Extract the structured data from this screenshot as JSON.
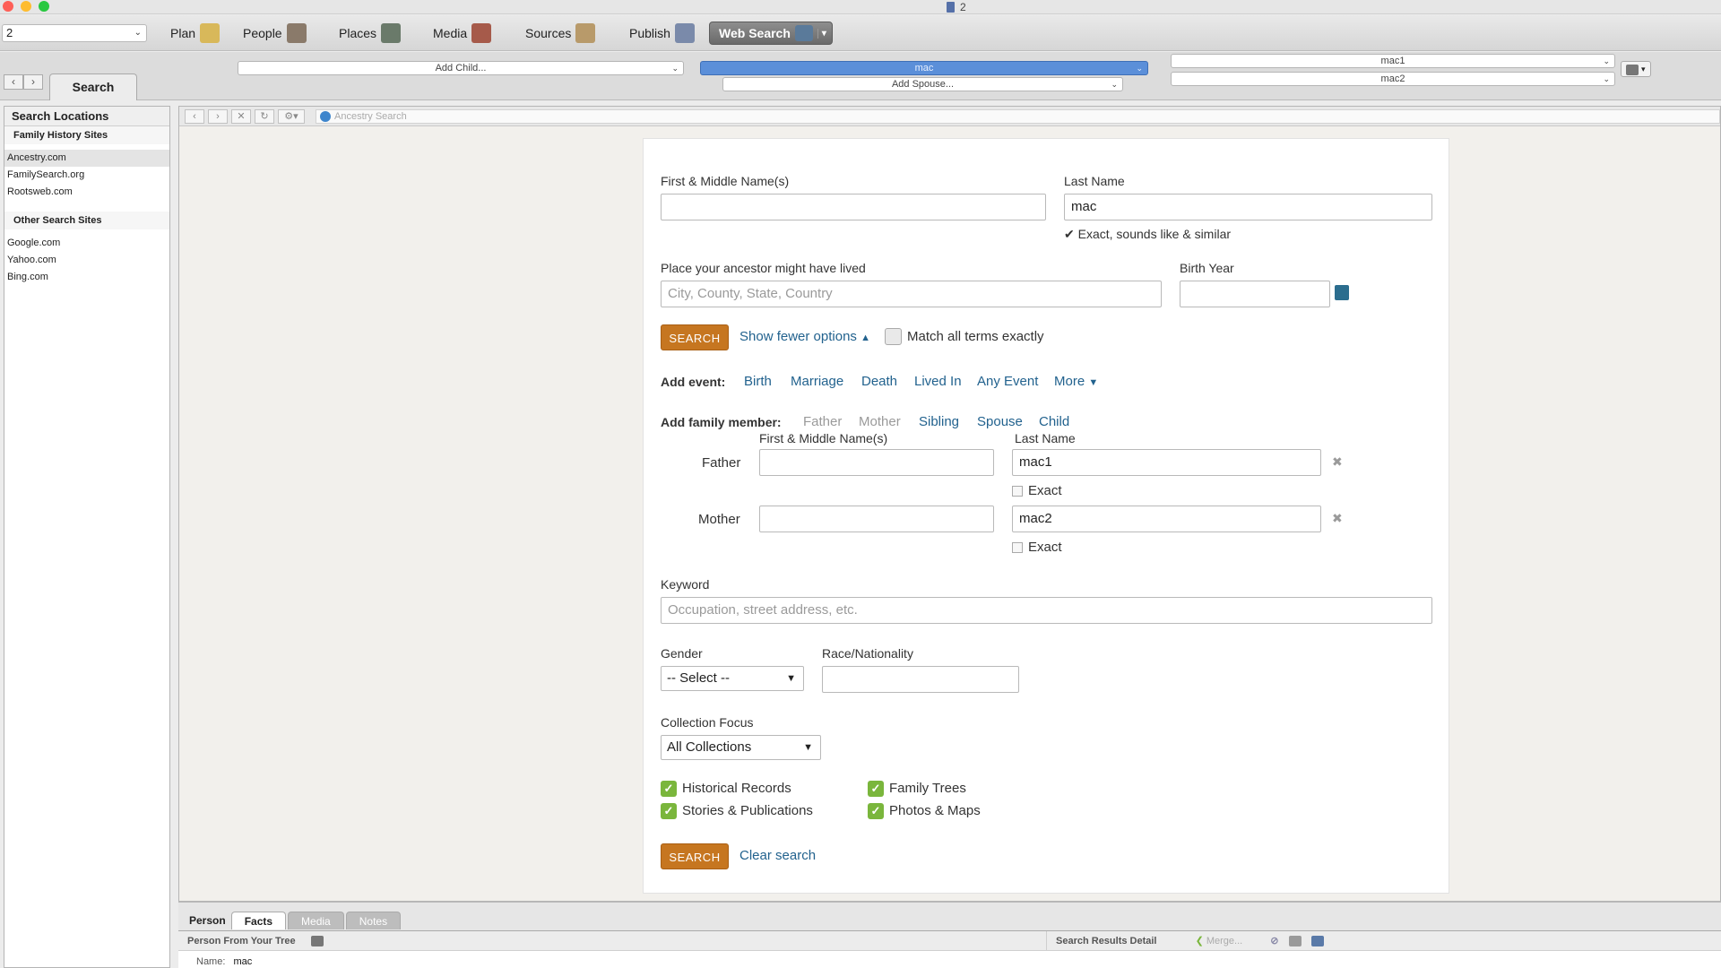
{
  "window": {
    "title": "2"
  },
  "toolbar": {
    "tree_select": "2",
    "buttons": [
      {
        "label": "Plan",
        "icon": "plan-icon"
      },
      {
        "label": "People",
        "icon": "people-icon"
      },
      {
        "label": "Places",
        "icon": "places-icon"
      },
      {
        "label": "Media",
        "icon": "media-icon"
      },
      {
        "label": "Sources",
        "icon": "sources-icon"
      },
      {
        "label": "Publish",
        "icon": "publish-icon"
      },
      {
        "label": "Web Search",
        "icon": "web-search-icon",
        "active": true
      }
    ]
  },
  "subbar": {
    "search_tab": "Search",
    "add_child": "Add Child...",
    "selected_person": "mac",
    "add_spouse": "Add Spouse...",
    "father_combo": "mac1",
    "mother_combo": "mac2"
  },
  "sidebar": {
    "header": "Search Locations",
    "groups": [
      {
        "title": "Family History Sites",
        "items": [
          "Ancestry.com",
          "FamilySearch.org",
          "Rootsweb.com"
        ]
      },
      {
        "title": "Other Search Sites",
        "items": [
          "Google.com",
          "Yahoo.com",
          "Bing.com"
        ]
      }
    ],
    "selected": "Ancestry.com"
  },
  "browser": {
    "address": "Ancestry Search"
  },
  "form": {
    "first_name_label": "First & Middle Name(s)",
    "first_name_value": "",
    "last_name_label": "Last Name",
    "last_name_value": "mac",
    "exact_note": "Exact, sounds like & similar",
    "place_label": "Place your ancestor might have lived",
    "place_placeholder": "City, County, State, Country",
    "birth_year_label": "Birth Year",
    "birth_year_value": "",
    "search_button": "SEARCH",
    "show_fewer": "Show fewer options",
    "match_exact": "Match all terms exactly",
    "add_event_label": "Add event:",
    "events": [
      "Birth",
      "Marriage",
      "Death",
      "Lived In",
      "Any Event",
      "More"
    ],
    "add_family_label": "Add family member:",
    "family_members": [
      "Father",
      "Mother",
      "Sibling",
      "Spouse",
      "Child"
    ],
    "family_first_label": "First & Middle Name(s)",
    "family_last_label": "Last Name",
    "father_label": "Father",
    "father_first": "",
    "father_last": "mac1",
    "mother_label": "Mother",
    "mother_first": "",
    "mother_last": "mac2",
    "exact_label": "Exact",
    "keyword_label": "Keyword",
    "keyword_placeholder": "Occupation, street address, etc.",
    "gender_label": "Gender",
    "gender_value": "-- Select --",
    "race_label": "Race/Nationality",
    "race_value": "",
    "collection_label": "Collection Focus",
    "collection_value": "All Collections",
    "categories": [
      "Historical Records",
      "Family Trees",
      "Stories & Publications",
      "Photos & Maps"
    ],
    "clear_search": "Clear search"
  },
  "bottom": {
    "tabs": [
      "Person",
      "Facts",
      "Media",
      "Notes"
    ],
    "active_tab": "Facts",
    "person_section": "Person From Your Tree",
    "name_label": "Name:",
    "name_value": "mac",
    "results_section": "Search Results Detail",
    "merge_label": "Merge..."
  }
}
